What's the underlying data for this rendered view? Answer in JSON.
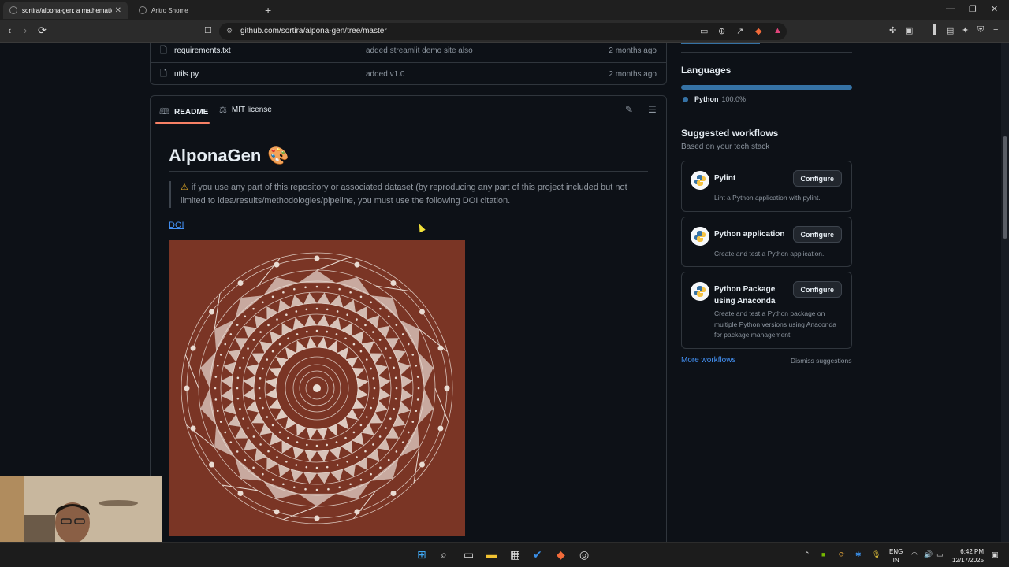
{
  "browser": {
    "tabs": [
      {
        "title": "sortira/alpona-gen: a mathematic"
      },
      {
        "title": "Aritro Shome"
      }
    ],
    "url": "github.com/sortira/alpona-gen/tree/master"
  },
  "files": [
    {
      "name": "requirements.txt",
      "message": "added streamlit demo site also",
      "time": "2 months ago"
    },
    {
      "name": "utils.py",
      "message": "added v1.0",
      "time": "2 months ago"
    }
  ],
  "readme": {
    "tabs": [
      "README",
      "MIT license"
    ],
    "title": "AlponaGen",
    "notice": "if you use any part of this repository or associated dataset (by reproducing any part of this project included but not limited to idea/results/methodologies/pipeline, you must use the following DOI citation.",
    "doi_text": "DOI"
  },
  "sidebar": {
    "languages_title": "Languages",
    "language": {
      "name": "Python",
      "percent": "100.0%",
      "fraction": 1.0,
      "color": "#3572A5"
    },
    "workflows_title": "Suggested workflows",
    "workflows_sub": "Based on your tech stack",
    "workflows": [
      {
        "title": "Pylint",
        "desc": "Lint a Python application with pylint.",
        "button": "Configure"
      },
      {
        "title": "Python application",
        "desc": "Create and test a Python application.",
        "button": "Configure"
      },
      {
        "title": "Python Package using Anaconda",
        "desc": "Create and test a Python package on multiple Python versions using Anaconda for package management.",
        "button": "Configure"
      }
    ],
    "more": "More workflows",
    "dismiss": "Dismiss suggestions"
  },
  "taskbar": {
    "lang_line1": "ENG",
    "lang_line2": "IN",
    "time": "6:42 PM",
    "date": "12/17/2025"
  },
  "colors": {
    "accent": "#4493f8",
    "tab_underline": "#f78166",
    "art_bg": "#7a3525"
  }
}
